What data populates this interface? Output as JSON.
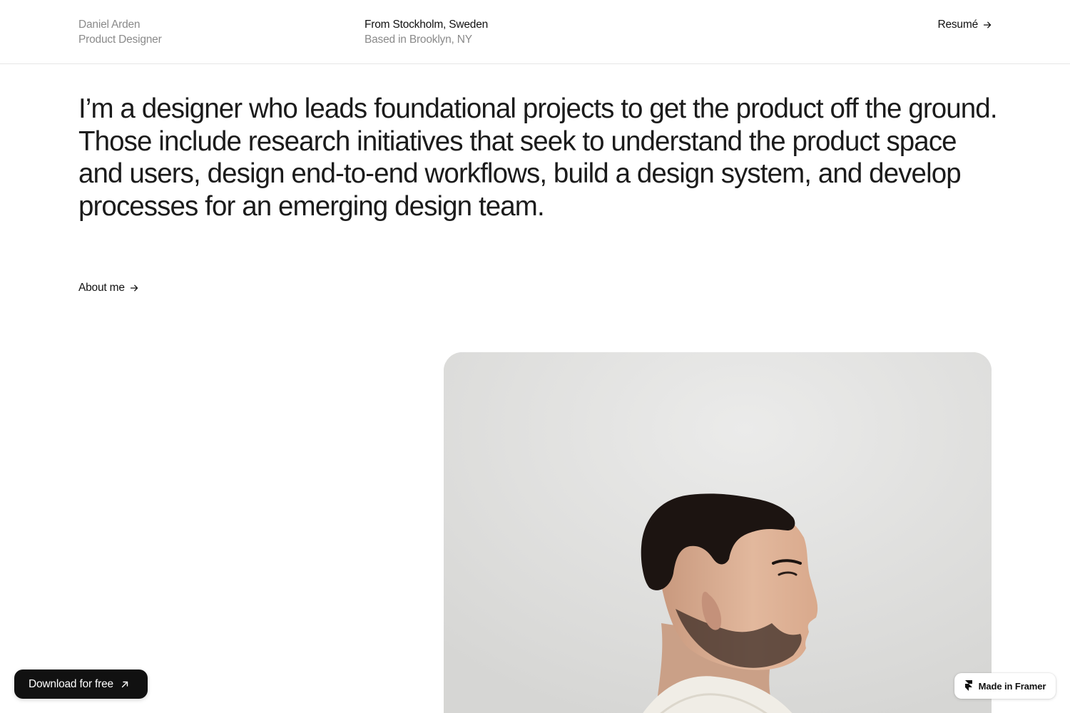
{
  "header": {
    "name": "Daniel Arden",
    "role": "Product Designer",
    "origin": "From Stockholm, Sweden",
    "based": "Based in Brooklyn, NY",
    "resume_label": "Resumé",
    "resume_icon": "arrow-right-icon"
  },
  "intro": {
    "text": "I’m a designer who leads foundational projects to get the product off the ground. Those include research initiatives that seek to understand the product space and users, design end-to-end workflows, build a design system, and develop processes for an emerging design team."
  },
  "about": {
    "label": "About me",
    "icon": "arrow-right-icon"
  },
  "portrait": {
    "alt": "Portrait of Daniel Arden in profile"
  },
  "floating": {
    "download_label": "Download for free",
    "download_icon": "arrow-up-right-icon",
    "framer_label": "Made in Framer",
    "framer_icon": "framer-logo-icon"
  },
  "colors": {
    "text": "#111111",
    "muted": "#8a8a8a",
    "divider": "#e6e6e6",
    "button_bg": "#111111"
  }
}
